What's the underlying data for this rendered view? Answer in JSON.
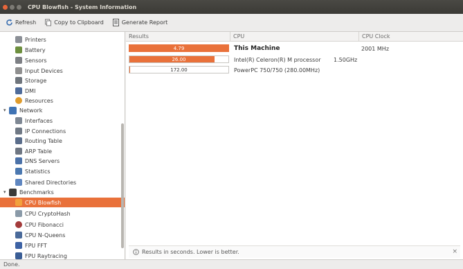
{
  "window": {
    "title": "CPU Blowfish - System Information"
  },
  "toolbar": {
    "refresh": "Refresh",
    "copy": "Copy to Clipboard",
    "report": "Generate Report"
  },
  "sidebar": {
    "items": [
      {
        "label": "Printers",
        "icon": "printer-icon",
        "color": "#8b8f96"
      },
      {
        "label": "Battery",
        "icon": "battery-icon",
        "color": "#6d8f3e"
      },
      {
        "label": "Sensors",
        "icon": "sensor-icon",
        "color": "#7d7f84"
      },
      {
        "label": "Input Devices",
        "icon": "keyboard-icon",
        "color": "#8f8f8f"
      },
      {
        "label": "Storage",
        "icon": "storage-icon",
        "color": "#6f757c"
      },
      {
        "label": "DMI",
        "icon": "dmi-icon",
        "color": "#4e6b9a"
      },
      {
        "label": "Resources",
        "icon": "resources-icon",
        "color": "#e09c2c"
      },
      {
        "label": "Network",
        "icon": "network-icon",
        "color": "#3f73b4"
      },
      {
        "label": "Interfaces",
        "icon": "interfaces-icon",
        "color": "#7e8793"
      },
      {
        "label": "IP Connections",
        "icon": "ip-connections-icon",
        "color": "#6f7884"
      },
      {
        "label": "Routing Table",
        "icon": "routing-icon",
        "color": "#5a6d8a"
      },
      {
        "label": "ARP Table",
        "icon": "arp-icon",
        "color": "#6e7682"
      },
      {
        "label": "DNS Servers",
        "icon": "dns-icon",
        "color": "#4b71a8"
      },
      {
        "label": "Statistics",
        "icon": "statistics-icon",
        "color": "#4b78b0"
      },
      {
        "label": "Shared Directories",
        "icon": "folder-icon",
        "color": "#5f86c0"
      },
      {
        "label": "Benchmarks",
        "icon": "benchmarks-icon",
        "color": "#3a3a3a"
      },
      {
        "label": "CPU Blowfish",
        "icon": "blowfish-icon",
        "color": "#f2a13c"
      },
      {
        "label": "CPU CryptoHash",
        "icon": "cryptohash-icon",
        "color": "#8a9aa8"
      },
      {
        "label": "CPU Fibonacci",
        "icon": "fibonacci-icon",
        "color": "#a33b3b"
      },
      {
        "label": "CPU N-Queens",
        "icon": "nqueens-icon",
        "color": "#4a6a9a"
      },
      {
        "label": "FPU FFT",
        "icon": "fft-icon",
        "color": "#3d62a4"
      },
      {
        "label": "FPU Raytracing",
        "icon": "raytracing-icon",
        "color": "#3a5d95"
      }
    ]
  },
  "table": {
    "headers": {
      "results": "Results",
      "cpu": "CPU",
      "clock": "CPU Clock"
    },
    "rows": [
      {
        "value": "4.79",
        "fraction": 1.0,
        "cpu": "This Machine",
        "clock": "2001 MHz"
      },
      {
        "value": "26.00",
        "fraction": 0.86,
        "cpu": "Intel(R) Celeron(R) M processor",
        "clock": "1.50GHz"
      },
      {
        "value": "172.00",
        "fraction": 0.01,
        "cpu": "PowerPC 750/750 (280.00MHz)",
        "clock": ""
      }
    ]
  },
  "footer": {
    "hint": "Results in seconds. Lower is better.",
    "close": "×"
  },
  "status": {
    "text": "Done."
  },
  "colors": {
    "accent": "#e9713a",
    "selection": "#e9713a"
  }
}
